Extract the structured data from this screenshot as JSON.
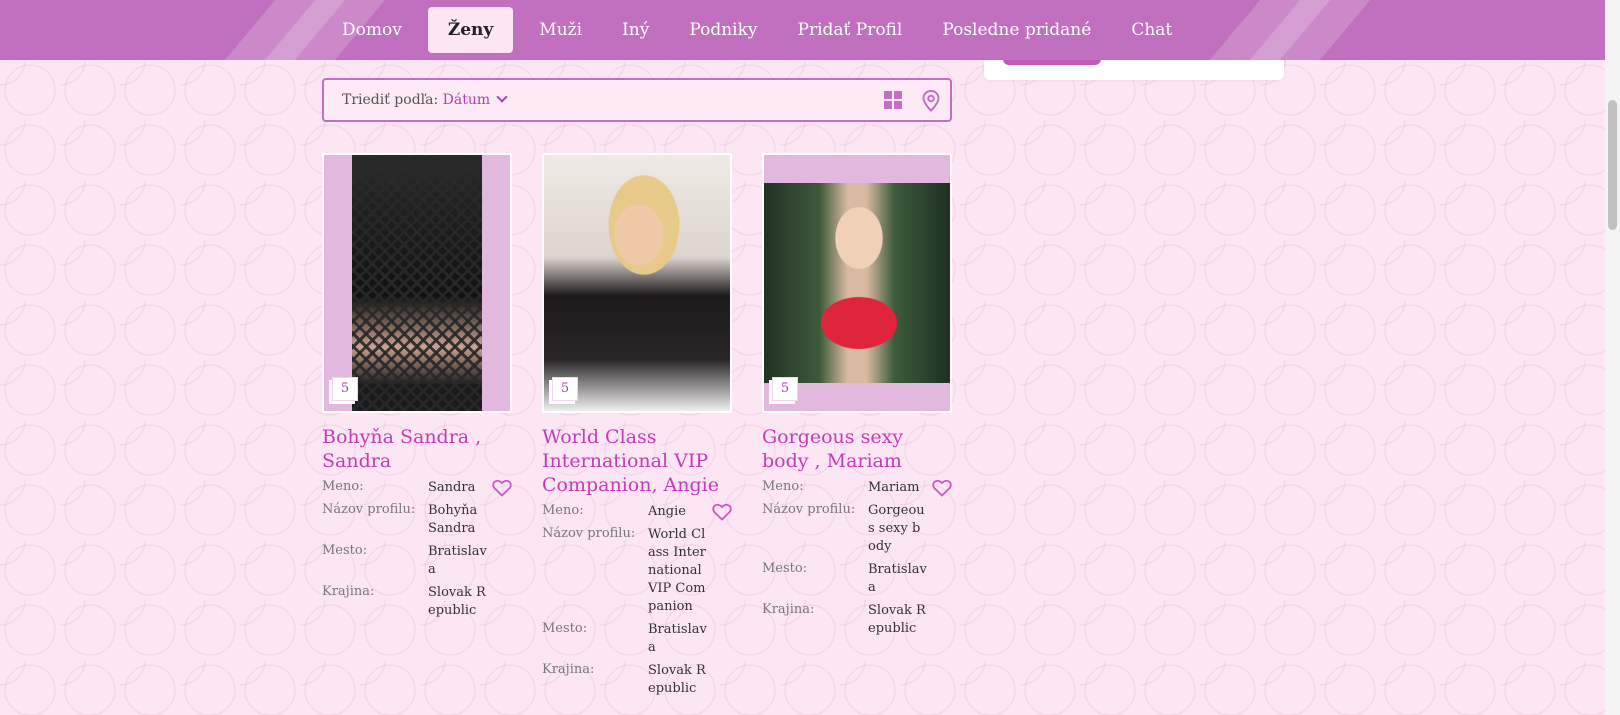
{
  "nav": {
    "items": [
      {
        "label": "Domov",
        "active": false
      },
      {
        "label": "Ženy",
        "active": true
      },
      {
        "label": "Muži",
        "active": false
      },
      {
        "label": "Iný",
        "active": false
      },
      {
        "label": "Podniky",
        "active": false
      },
      {
        "label": "Pridať Profil",
        "active": false
      },
      {
        "label": "Posledne pridané",
        "active": false
      },
      {
        "label": "Chat",
        "active": false
      }
    ]
  },
  "sort": {
    "label": "Triediť podľa:",
    "value": "Dátum"
  },
  "colors": {
    "accent": "#c070bf",
    "link": "#c43bb8",
    "background": "#fde6f3"
  },
  "field_labels": {
    "name": "Meno:",
    "profile": "Názov profilu:",
    "city": "Mesto:",
    "country": "Krajina:"
  },
  "profiles": [
    {
      "title": "Bohyňa Sandra , Sandra",
      "photo_count": "5",
      "name": "Sandra",
      "profile_name": "Bohyňa Sandra",
      "city": "Bratislava",
      "country": "Slovak Republic"
    },
    {
      "title": "World Class International VIP Companion, Angie",
      "photo_count": "5",
      "name": "Angie",
      "profile_name": "World Class International VIP Companion",
      "city": "Bratislava",
      "country": "Slovak Republic"
    },
    {
      "title": "Gorgeous sexy body , Mariam",
      "photo_count": "5",
      "name": "Mariam",
      "profile_name": "Gorgeous sexy body",
      "city": "Bratislava",
      "country": "Slovak Republic"
    }
  ]
}
